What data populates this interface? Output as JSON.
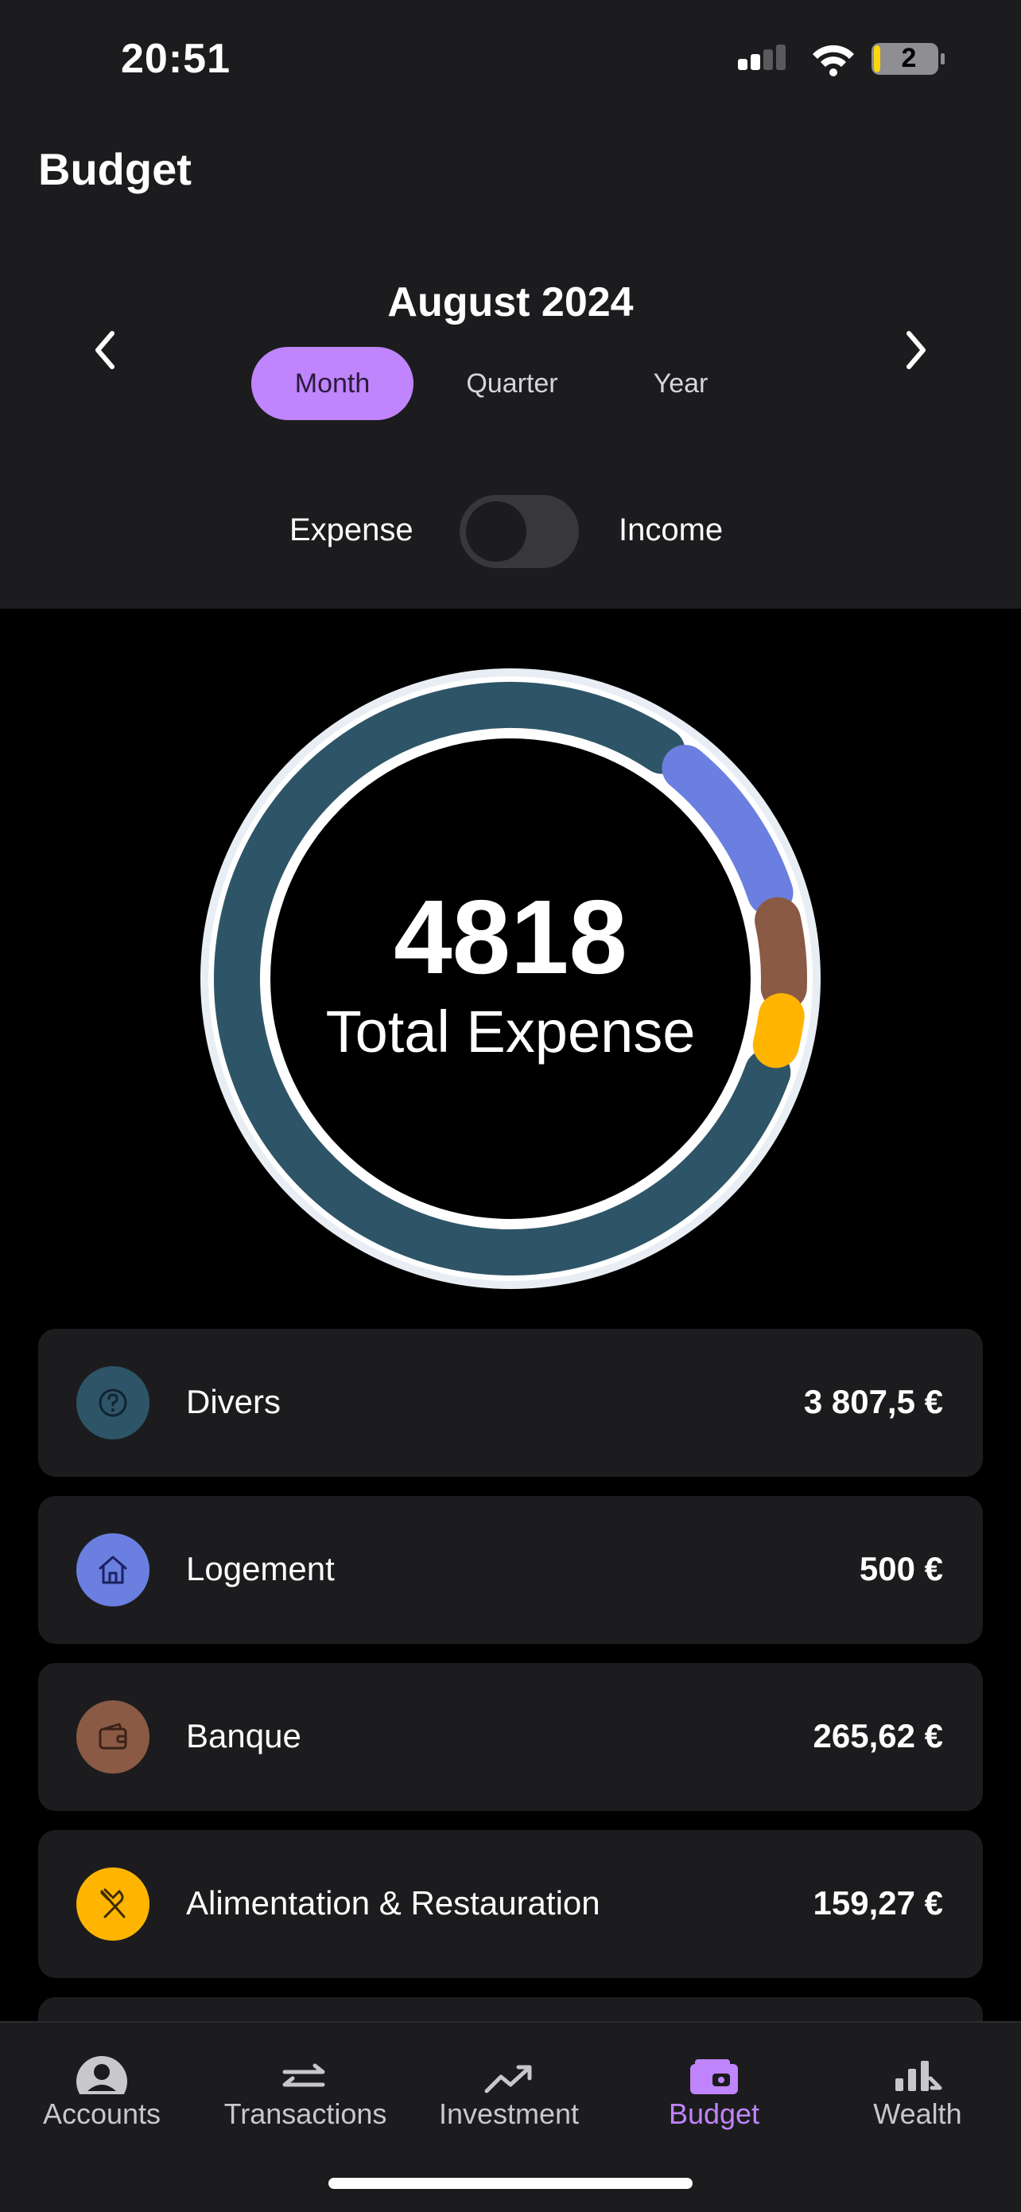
{
  "status_bar": {
    "time": "20:51",
    "battery": "2"
  },
  "header": {
    "title": "Budget",
    "period": "August 2024",
    "tabs": [
      {
        "label": "Month",
        "active": true
      },
      {
        "label": "Quarter",
        "active": false
      },
      {
        "label": "Year",
        "active": false
      }
    ],
    "toggle": {
      "left_label": "Expense",
      "right_label": "Income",
      "state": "Expense"
    }
  },
  "summary": {
    "value": "4818",
    "label": "Total Expense"
  },
  "categories": [
    {
      "name": "Divers",
      "amount": "3 807,5 €",
      "value": 3807.5,
      "color": "#2e5567",
      "icon": "question-circle-icon"
    },
    {
      "name": "Logement",
      "amount": "500 €",
      "value": 500,
      "color": "#6b7fe0",
      "icon": "home-icon"
    },
    {
      "name": "Banque",
      "amount": "265,62 €",
      "value": 265.62,
      "color": "#8a5a44",
      "icon": "wallet-icon"
    },
    {
      "name": "Alimentation & Restauration",
      "amount": "159,27 €",
      "value": 159.27,
      "color": "#ffb400",
      "icon": "fork-knife-icon"
    }
  ],
  "tabbar": [
    {
      "label": "Accounts",
      "icon": "person-icon",
      "active": false
    },
    {
      "label": "Transactions",
      "icon": "transfer-arrows-icon",
      "active": false
    },
    {
      "label": "Investment",
      "icon": "trend-up-icon",
      "active": false
    },
    {
      "label": "Budget",
      "icon": "wallet-icon",
      "active": true
    },
    {
      "label": "Wealth",
      "icon": "bar-chart-icon",
      "active": false
    }
  ],
  "colors": {
    "accent": "#c084fc",
    "surface": "#1c1c1e",
    "background": "#000000"
  }
}
